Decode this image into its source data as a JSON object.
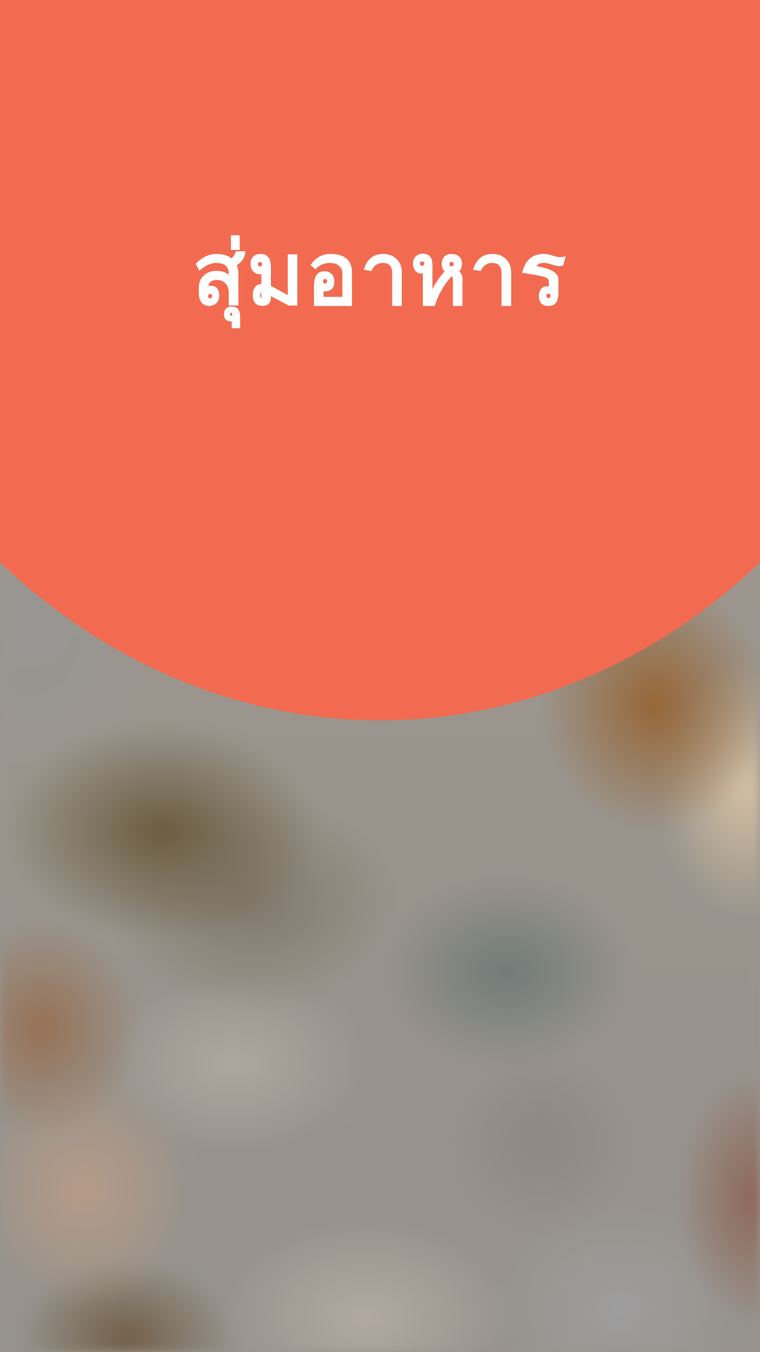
{
  "header": {
    "title": "สุ่มอาหาร",
    "accent_color": "#f26b50",
    "text_color": "#ffffff"
  },
  "background": {
    "description_color": "#9a958e"
  }
}
